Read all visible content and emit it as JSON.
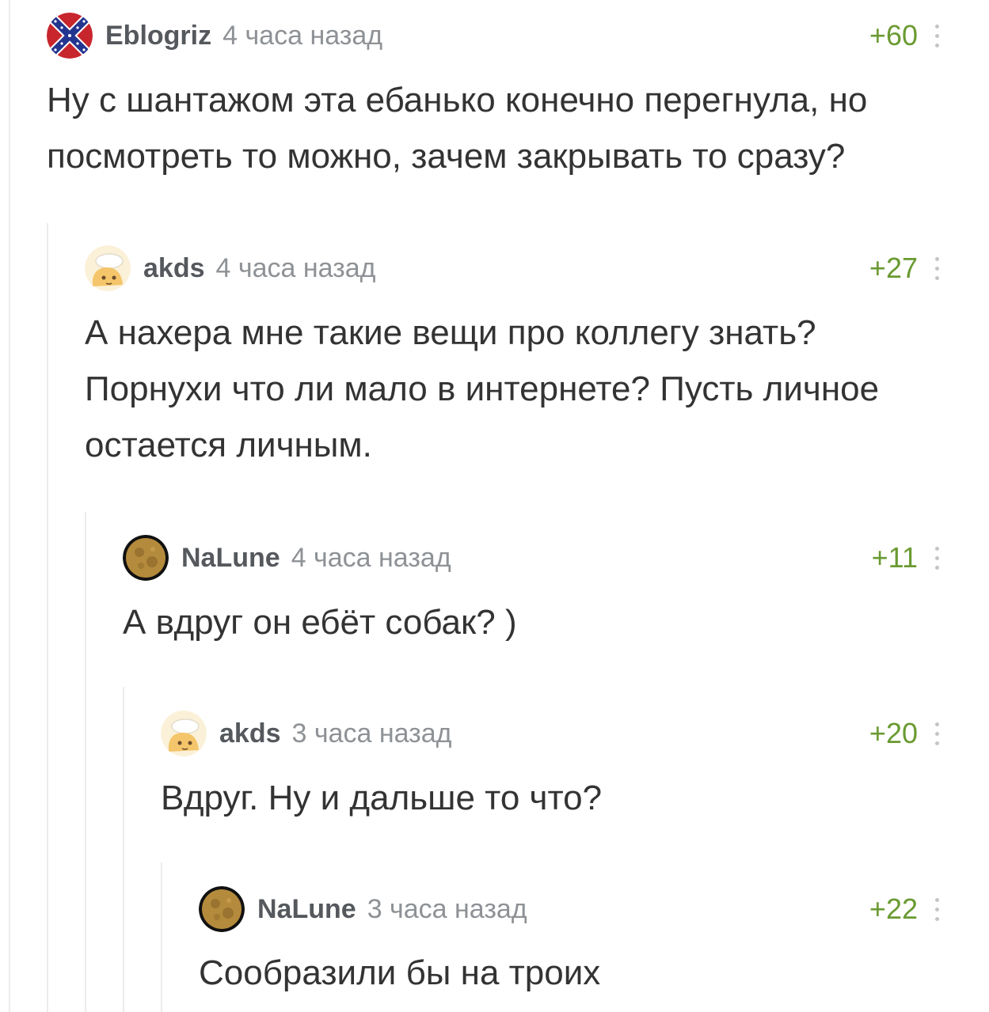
{
  "comments": [
    {
      "author": "Eblogriz",
      "time": "4 часа назад",
      "score": "+60",
      "avatar_icon": "confederate-flag-icon",
      "lines": [
        "Ну с шантажом эта ебанько конечно перегнула, но",
        "посмотреть то можно, зачем закрывать то сразу?"
      ]
    },
    {
      "author": "akds",
      "time": "4 часа назад",
      "score": "+27",
      "avatar_icon": "cartoon-face-icon",
      "lines": [
        "А нахера мне такие вещи про коллегу знать?",
        "Порнухи что ли мало в интернете? Пусть личное",
        "остается личным."
      ]
    },
    {
      "author": "NaLune",
      "time": "4 часа назад",
      "score": "+11",
      "avatar_icon": "moon-icon",
      "lines": [
        "А вдруг он ебёт собак? )"
      ]
    },
    {
      "author": "akds",
      "time": "3 часа назад",
      "score": "+20",
      "avatar_icon": "cartoon-face-icon",
      "lines": [
        "Вдруг. Ну и дальше то что?"
      ]
    },
    {
      "author": "NaLune",
      "time": "3 часа назад",
      "score": "+22",
      "avatar_icon": "moon-icon",
      "lines": [
        "Сообразили бы на троих"
      ]
    }
  ],
  "colors": {
    "score": "#6a9a31",
    "author": "#55585c",
    "time": "#8e9296",
    "text": "#333333",
    "thread_rail": "#ececec"
  }
}
